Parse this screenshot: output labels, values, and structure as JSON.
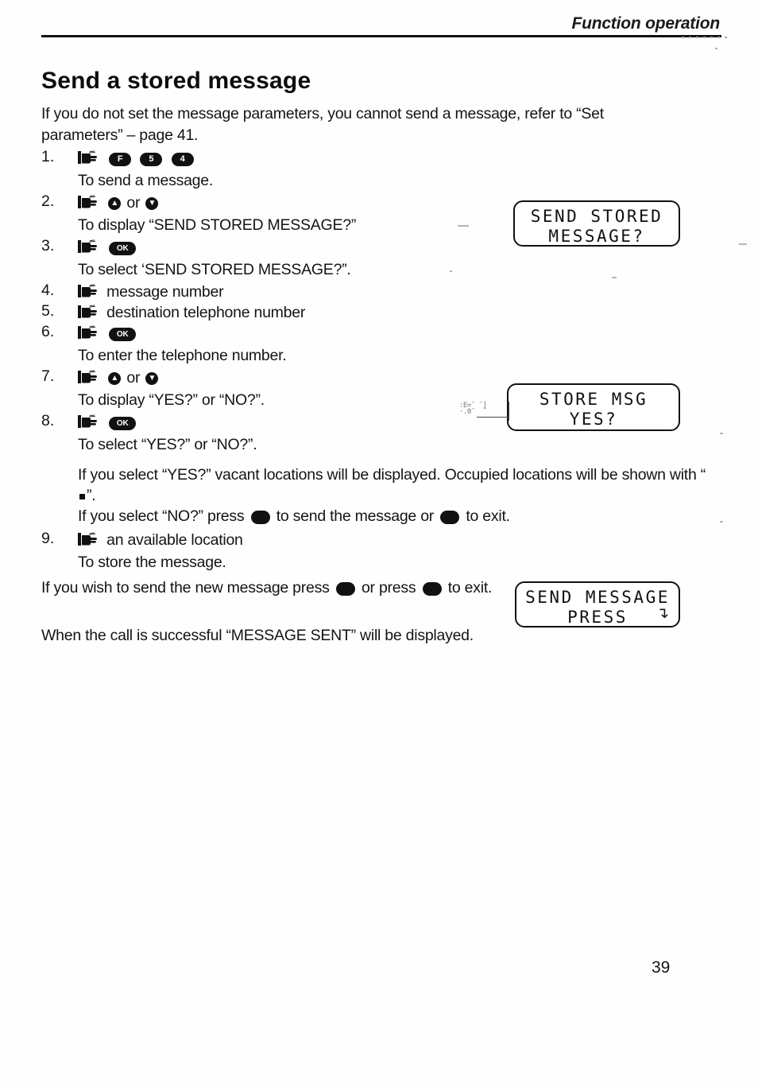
{
  "header": {
    "title": "Function operation"
  },
  "heading": "Send a stored message",
  "intro": "If you do not set the message parameters, you cannot send a message, refer to “Set parameters” – page 41.",
  "steps": [
    {
      "num": "1.",
      "icon": "pointing-hand-icon",
      "keys": [
        "F",
        "5",
        "4"
      ],
      "sub": "To send a message."
    },
    {
      "num": "2.",
      "icon": "pointing-hand-icon",
      "key_up": "▲",
      "conjunction": "or",
      "key_down": "▼",
      "sub": "To display “SEND STORED MESSAGE?”"
    },
    {
      "num": "3.",
      "icon": "pointing-hand-icon",
      "key_wide": "OK",
      "sub": "To select ‘SEND STORED MESSAGE?”."
    },
    {
      "num": "4.",
      "icon": "pointing-hand-icon",
      "label": "message number"
    },
    {
      "num": "5.",
      "icon": "pointing-hand-icon",
      "label": "destination telephone number"
    },
    {
      "num": "6.",
      "icon": "pointing-hand-icon",
      "key_wide": "OK",
      "sub": "To enter the telephone number."
    },
    {
      "num": "7.",
      "icon": "pointing-hand-icon",
      "key_up": "▲",
      "conjunction": "or",
      "key_down": "▼",
      "sub": "To display “YES?” or “NO?”."
    },
    {
      "num": "8.",
      "icon": "pointing-hand-icon",
      "key_wide": "OK",
      "sub": "To select “YES?” or “NO?”.",
      "para1_before": "If you select “YES?” vacant locations will be displayed. Occupied locations will be shown with “",
      "para1_after": "”.",
      "para2_before": "If you select “NO?” press ",
      "para2_mid": " to send the message or ",
      "para2_after": " to exit."
    },
    {
      "num": "9.",
      "icon": "pointing-hand-icon",
      "label": "an available location",
      "sub": "To store the message."
    }
  ],
  "tail": {
    "a_before": "If you wish to send the new message press ",
    "a_mid": " or press ",
    "a_after": " to exit.",
    "b": "When the call is successful “MESSAGE SENT” will be displayed."
  },
  "lcd_displays": [
    {
      "line1": "SEND STORED",
      "line2": "MESSAGE?",
      "arrow": ""
    },
    {
      "line1": "STORE MSG",
      "line2": "YES?",
      "arrow": ""
    },
    {
      "line1": "SEND MESSAGE",
      "line2": "PRESS",
      "arrow": "↴"
    }
  ],
  "artifact_text": ":E=¯ ¯]\n·.0¯  ¯",
  "page_number": "39",
  "colors": {
    "ink": "#111111",
    "paper": "#fefefe"
  }
}
